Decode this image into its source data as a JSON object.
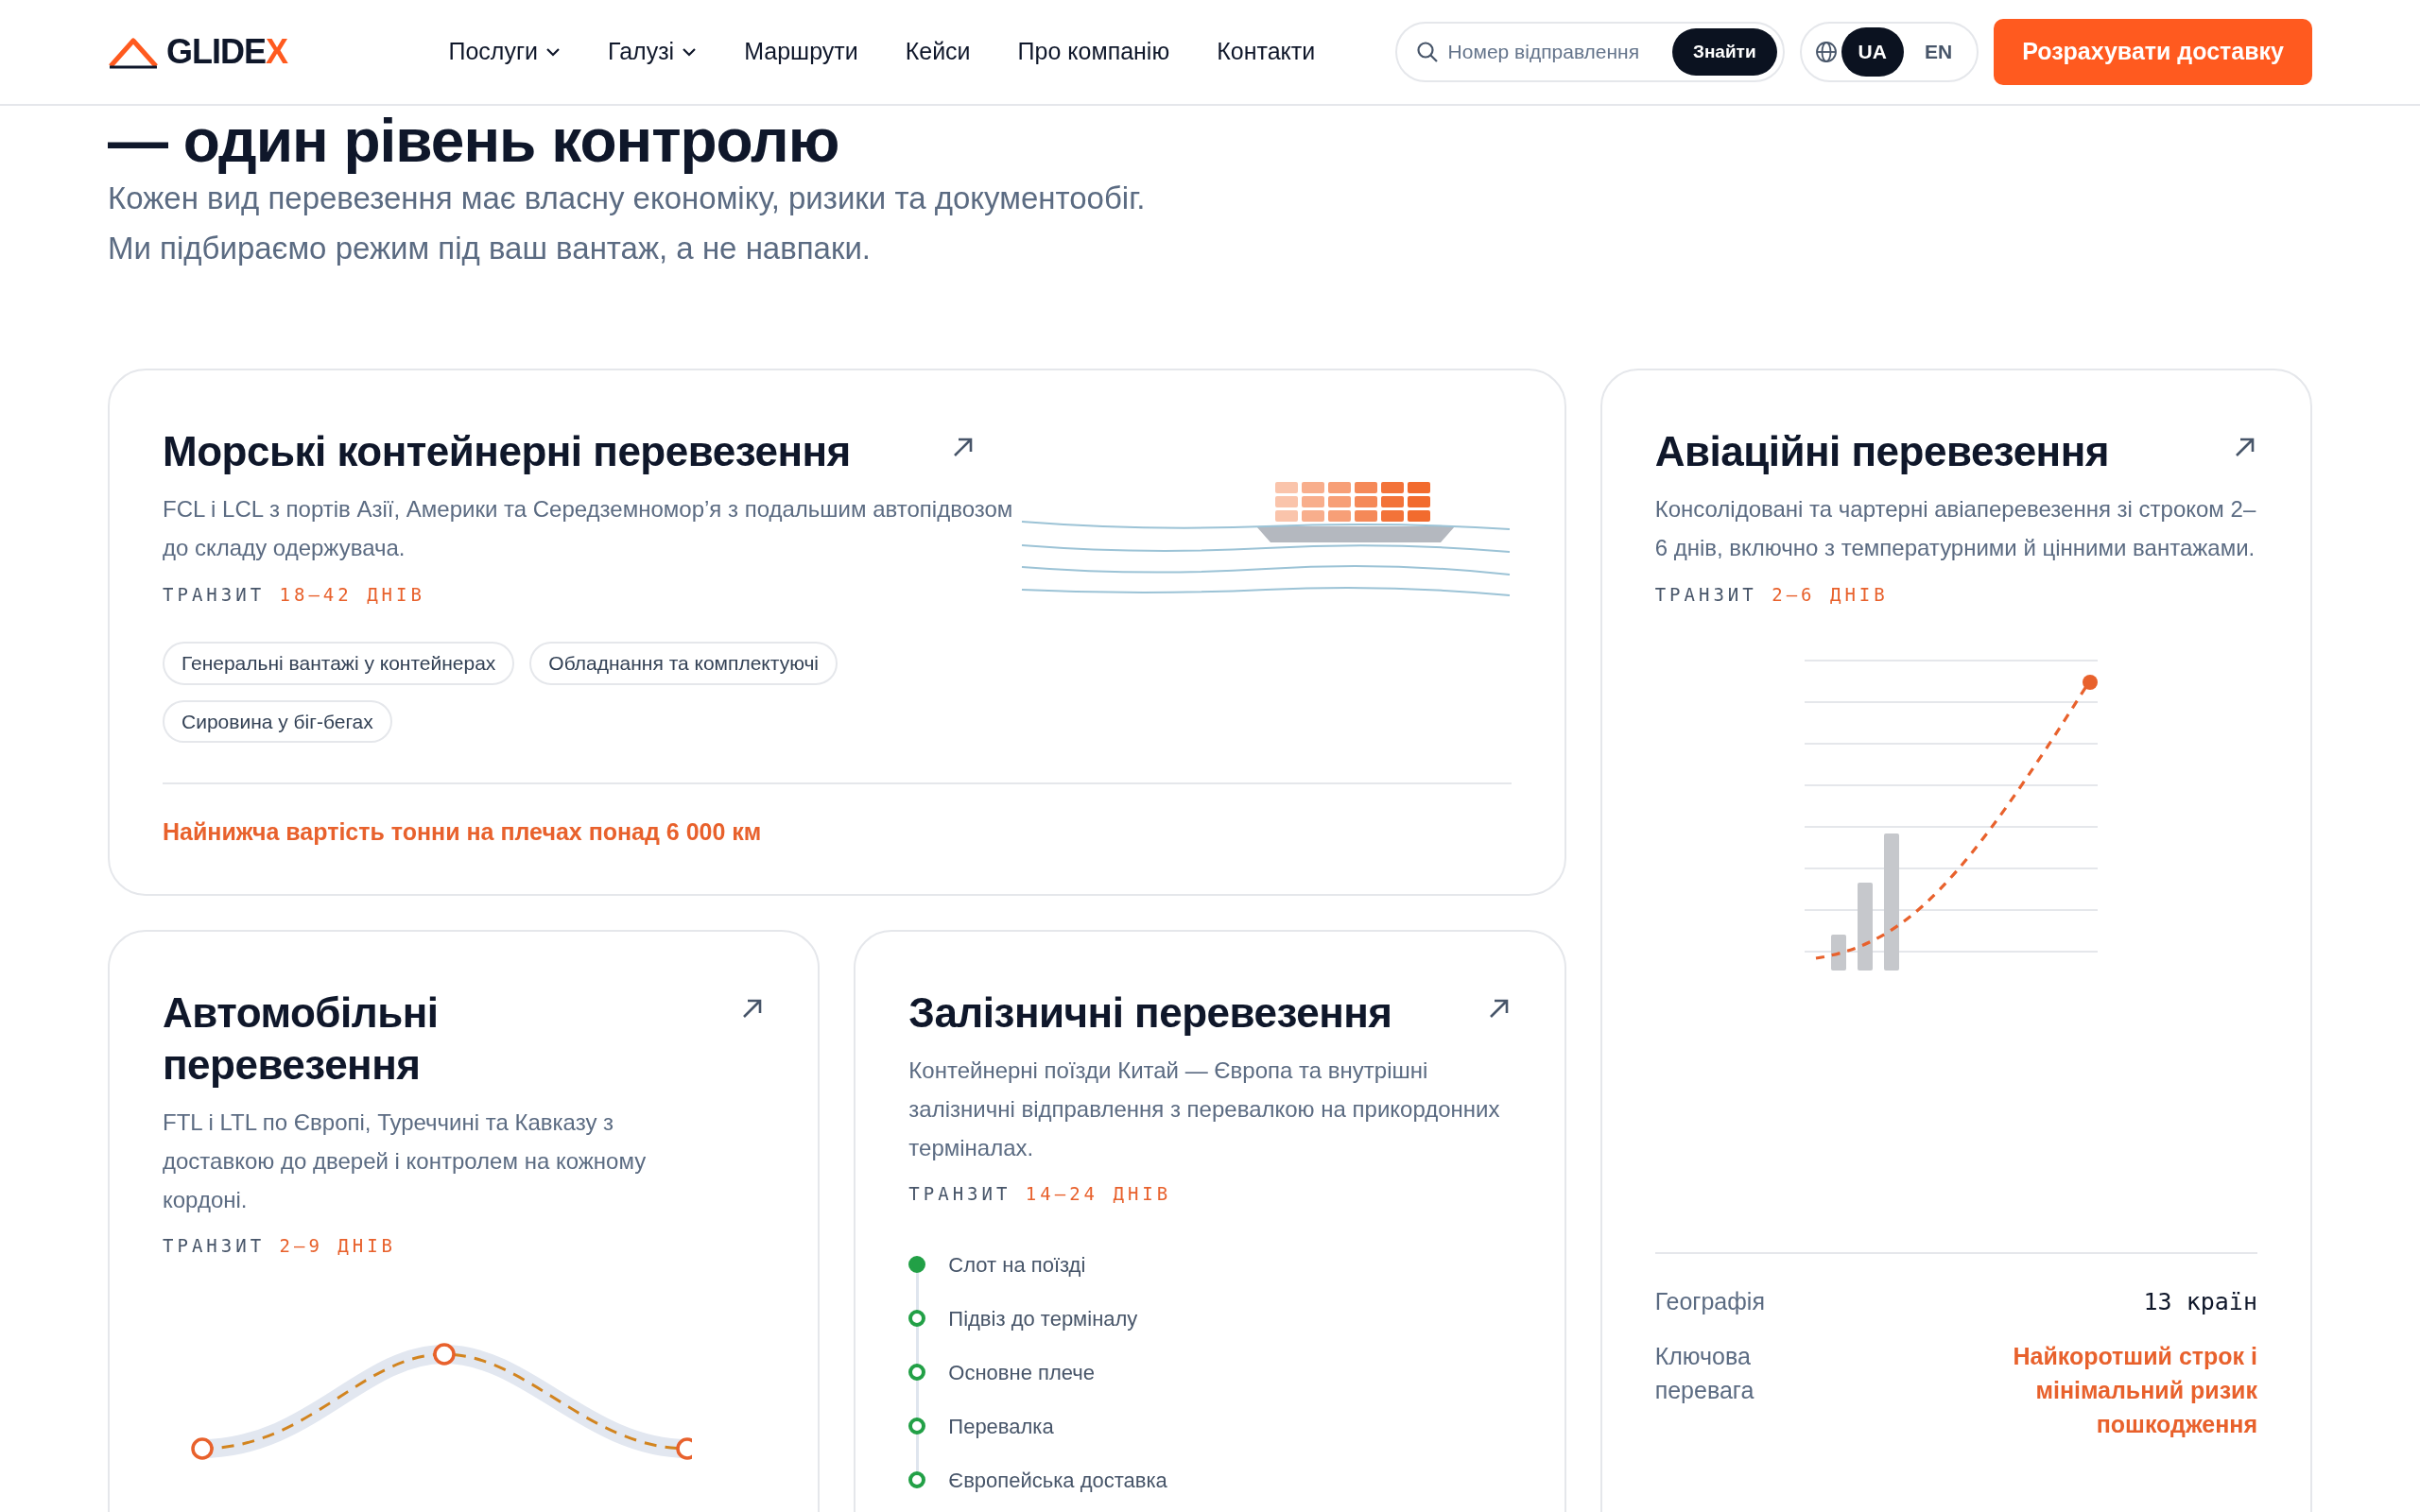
{
  "header": {
    "logo": {
      "text": "GLIDE",
      "accent": "X"
    },
    "nav": [
      {
        "label": "Послуги",
        "dropdown": true
      },
      {
        "label": "Галузі",
        "dropdown": true
      },
      {
        "label": "Маршрути",
        "dropdown": false
      },
      {
        "label": "Кейси",
        "dropdown": false
      },
      {
        "label": "Про компанію",
        "dropdown": false
      },
      {
        "label": "Контакти",
        "dropdown": false
      }
    ],
    "search": {
      "placeholder": "Номер відправлення",
      "button": "Знайти"
    },
    "languages": [
      {
        "label": "UA",
        "selected": true
      },
      {
        "label": "EN",
        "selected": false
      }
    ],
    "cta": "Розрахувати доставку"
  },
  "intro": {
    "heading": "— один рівень контролю",
    "text": "Кожен вид перевезення має власну економіку, ризики та документообіг. Ми підбираємо режим під ваш вантаж, а не навпаки."
  },
  "cards": [
    {
      "kind": "sea",
      "title": "Морські контейнерні перевезення",
      "text": "FCL і LCL з портів Азії, Америки та Середземномор’я з подальшим автопідвозом до складу одержувача.",
      "transit_label": "ТРАНЗИТ",
      "transit": "18–42 ДНІВ",
      "tags": [
        "Генеральні вантажі у контейнерах",
        "Обладнання та комплектуючі",
        "Сировина у біг-бегах"
      ],
      "note": "Найнижча вартість тонни на плечах понад 6 000 км"
    },
    {
      "kind": "air",
      "title": "Авіаційні перевезення",
      "text": "Консолідовані та чартерні авіаперевезення зі строком 2–6 днів, включно з температурними й цінними вантажами.",
      "transit_label": "ТРАНЗИТ",
      "transit": "2–6 ДНІВ",
      "facts": [
        {
          "label": "Географія",
          "value": "13 країн",
          "kind": "mono"
        },
        {
          "label": "Ключова перевага",
          "value": "Найкоротший строк і мінімальний ризик пошкодження",
          "kind": "accent"
        }
      ]
    },
    {
      "kind": "road",
      "title": "Автомобільні перевезення",
      "text": "FTL і LTL по Європі, Туреччині та Кавказу з доставкою до дверей і контролем на кожному кордоні.",
      "transit_label": "ТРАНЗИТ",
      "transit": "2–9 ДНІВ"
    },
    {
      "kind": "rail",
      "title": "Залізничні перевезення",
      "text": "Контейнерні поїзди Китай — Європа та внутрішні залізничні відправлення з перевалкою на прикордонних терміналах.",
      "transit_label": "ТРАНЗИТ",
      "transit": "14–24 ДНІВ",
      "steps": [
        {
          "label": "Слот на поїзді",
          "done": true
        },
        {
          "label": "Підвіз до терміналу",
          "done": false
        },
        {
          "label": "Основне плече",
          "done": false
        },
        {
          "label": "Перевалка",
          "done": false
        },
        {
          "label": "Європейська доставка",
          "done": false
        }
      ]
    }
  ]
}
